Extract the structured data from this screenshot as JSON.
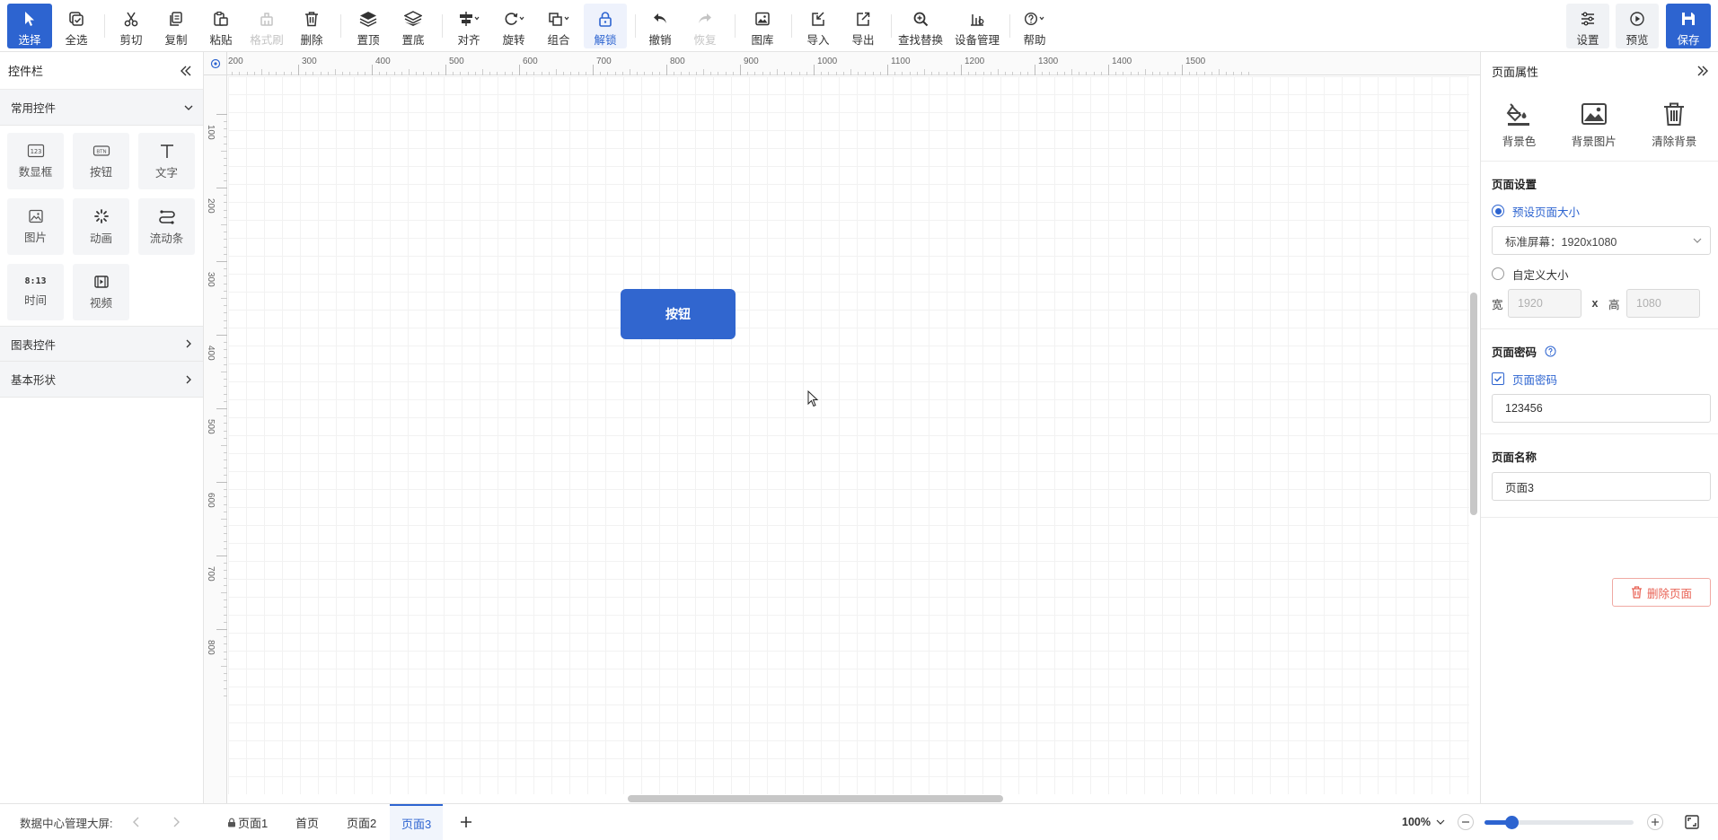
{
  "toolbar": {
    "select": "选择",
    "select_all": "全选",
    "cut": "剪切",
    "copy": "复制",
    "paste": "粘贴",
    "format_brush": "格式刷",
    "delete": "删除",
    "to_top": "置顶",
    "to_bottom": "置底",
    "align": "对齐",
    "rotate": "旋转",
    "group": "组合",
    "unlock": "解锁",
    "undo": "撤销",
    "redo": "恢复",
    "gallery": "图库",
    "import": "导入",
    "export": "导出",
    "find_replace": "查找替换",
    "device_manage": "设备管理",
    "help": "帮助",
    "settings": "设置",
    "preview": "预览",
    "save": "保存"
  },
  "left_panel": {
    "title": "控件栏",
    "common_category": "常用控件",
    "widgets": [
      {
        "label": "数显框",
        "icon": "digital-display-icon"
      },
      {
        "label": "按钮",
        "icon": "button-widget-icon"
      },
      {
        "label": "文字",
        "icon": "text-icon"
      },
      {
        "label": "图片",
        "icon": "image-icon"
      },
      {
        "label": "动画",
        "icon": "animation-icon"
      },
      {
        "label": "流动条",
        "icon": "flow-bar-icon"
      },
      {
        "label": "时间",
        "icon": "time-icon"
      },
      {
        "label": "视频",
        "icon": "video-icon"
      }
    ],
    "time_icon_text": "8:13",
    "num_icon_text": "123",
    "btn_icon_text": "BTN",
    "chart_category": "图表控件",
    "shape_category": "基本形状"
  },
  "canvas": {
    "ruler_x": [
      "200",
      "300",
      "400",
      "500",
      "600",
      "700",
      "800",
      "900",
      "1000",
      "1100",
      "1200",
      "1300",
      "1400",
      "1500"
    ],
    "ruler_y": [
      "100",
      "200",
      "300",
      "400",
      "500",
      "600",
      "700",
      "800"
    ],
    "button_label": "按钮"
  },
  "right_panel": {
    "title": "页面属性",
    "bg_color": "背景色",
    "bg_image": "背景图片",
    "clear_bg": "清除背景",
    "page_settings_title": "页面设置",
    "preset_size_label": "预设页面大小",
    "preset_size_value": "标准屏幕：1920x1080",
    "custom_size_label": "自定义大小",
    "width_label": "宽",
    "width_value": "1920",
    "times": "x",
    "height_label": "高",
    "height_value": "1080",
    "password_title": "页面密码",
    "password_checkbox": "页面密码",
    "password_value": "123456",
    "page_name_title": "页面名称",
    "page_name_value": "页面3",
    "delete_page": "删除页面"
  },
  "bottom": {
    "project_name": "数据中心管理大屏:",
    "tabs": [
      "页面1",
      "首页",
      "页面2",
      "页面3"
    ],
    "active_tab": "页面3",
    "zoom": "100%",
    "zoom_fraction": 0.18
  },
  "colors": {
    "accent": "#2d64d0",
    "button_fill": "#3166cf",
    "danger": "#e85f52"
  }
}
